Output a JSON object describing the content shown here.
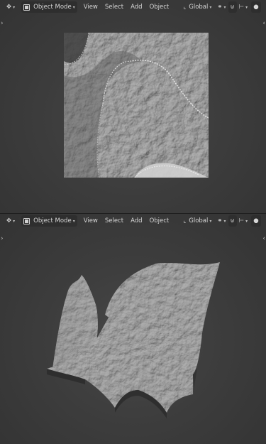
{
  "header": {
    "mode": "Object Mode",
    "menus": [
      "View",
      "Select",
      "Add",
      "Object"
    ],
    "transform_orientation": "Global"
  },
  "icons": {
    "editor_type": "transform-gizmo-icon",
    "mode_icon": "object-mode-icon",
    "orientation_icon": "transform-orientation-icon",
    "link": "link-icon",
    "snap": "snap-icon",
    "proportional": "proportional-edit-icon",
    "expand": "chevron-icon"
  },
  "colors": {
    "header_bg": "#3a3a3a",
    "viewport_bg": "#3d3d3d",
    "mesh": "#9a9a9a"
  }
}
